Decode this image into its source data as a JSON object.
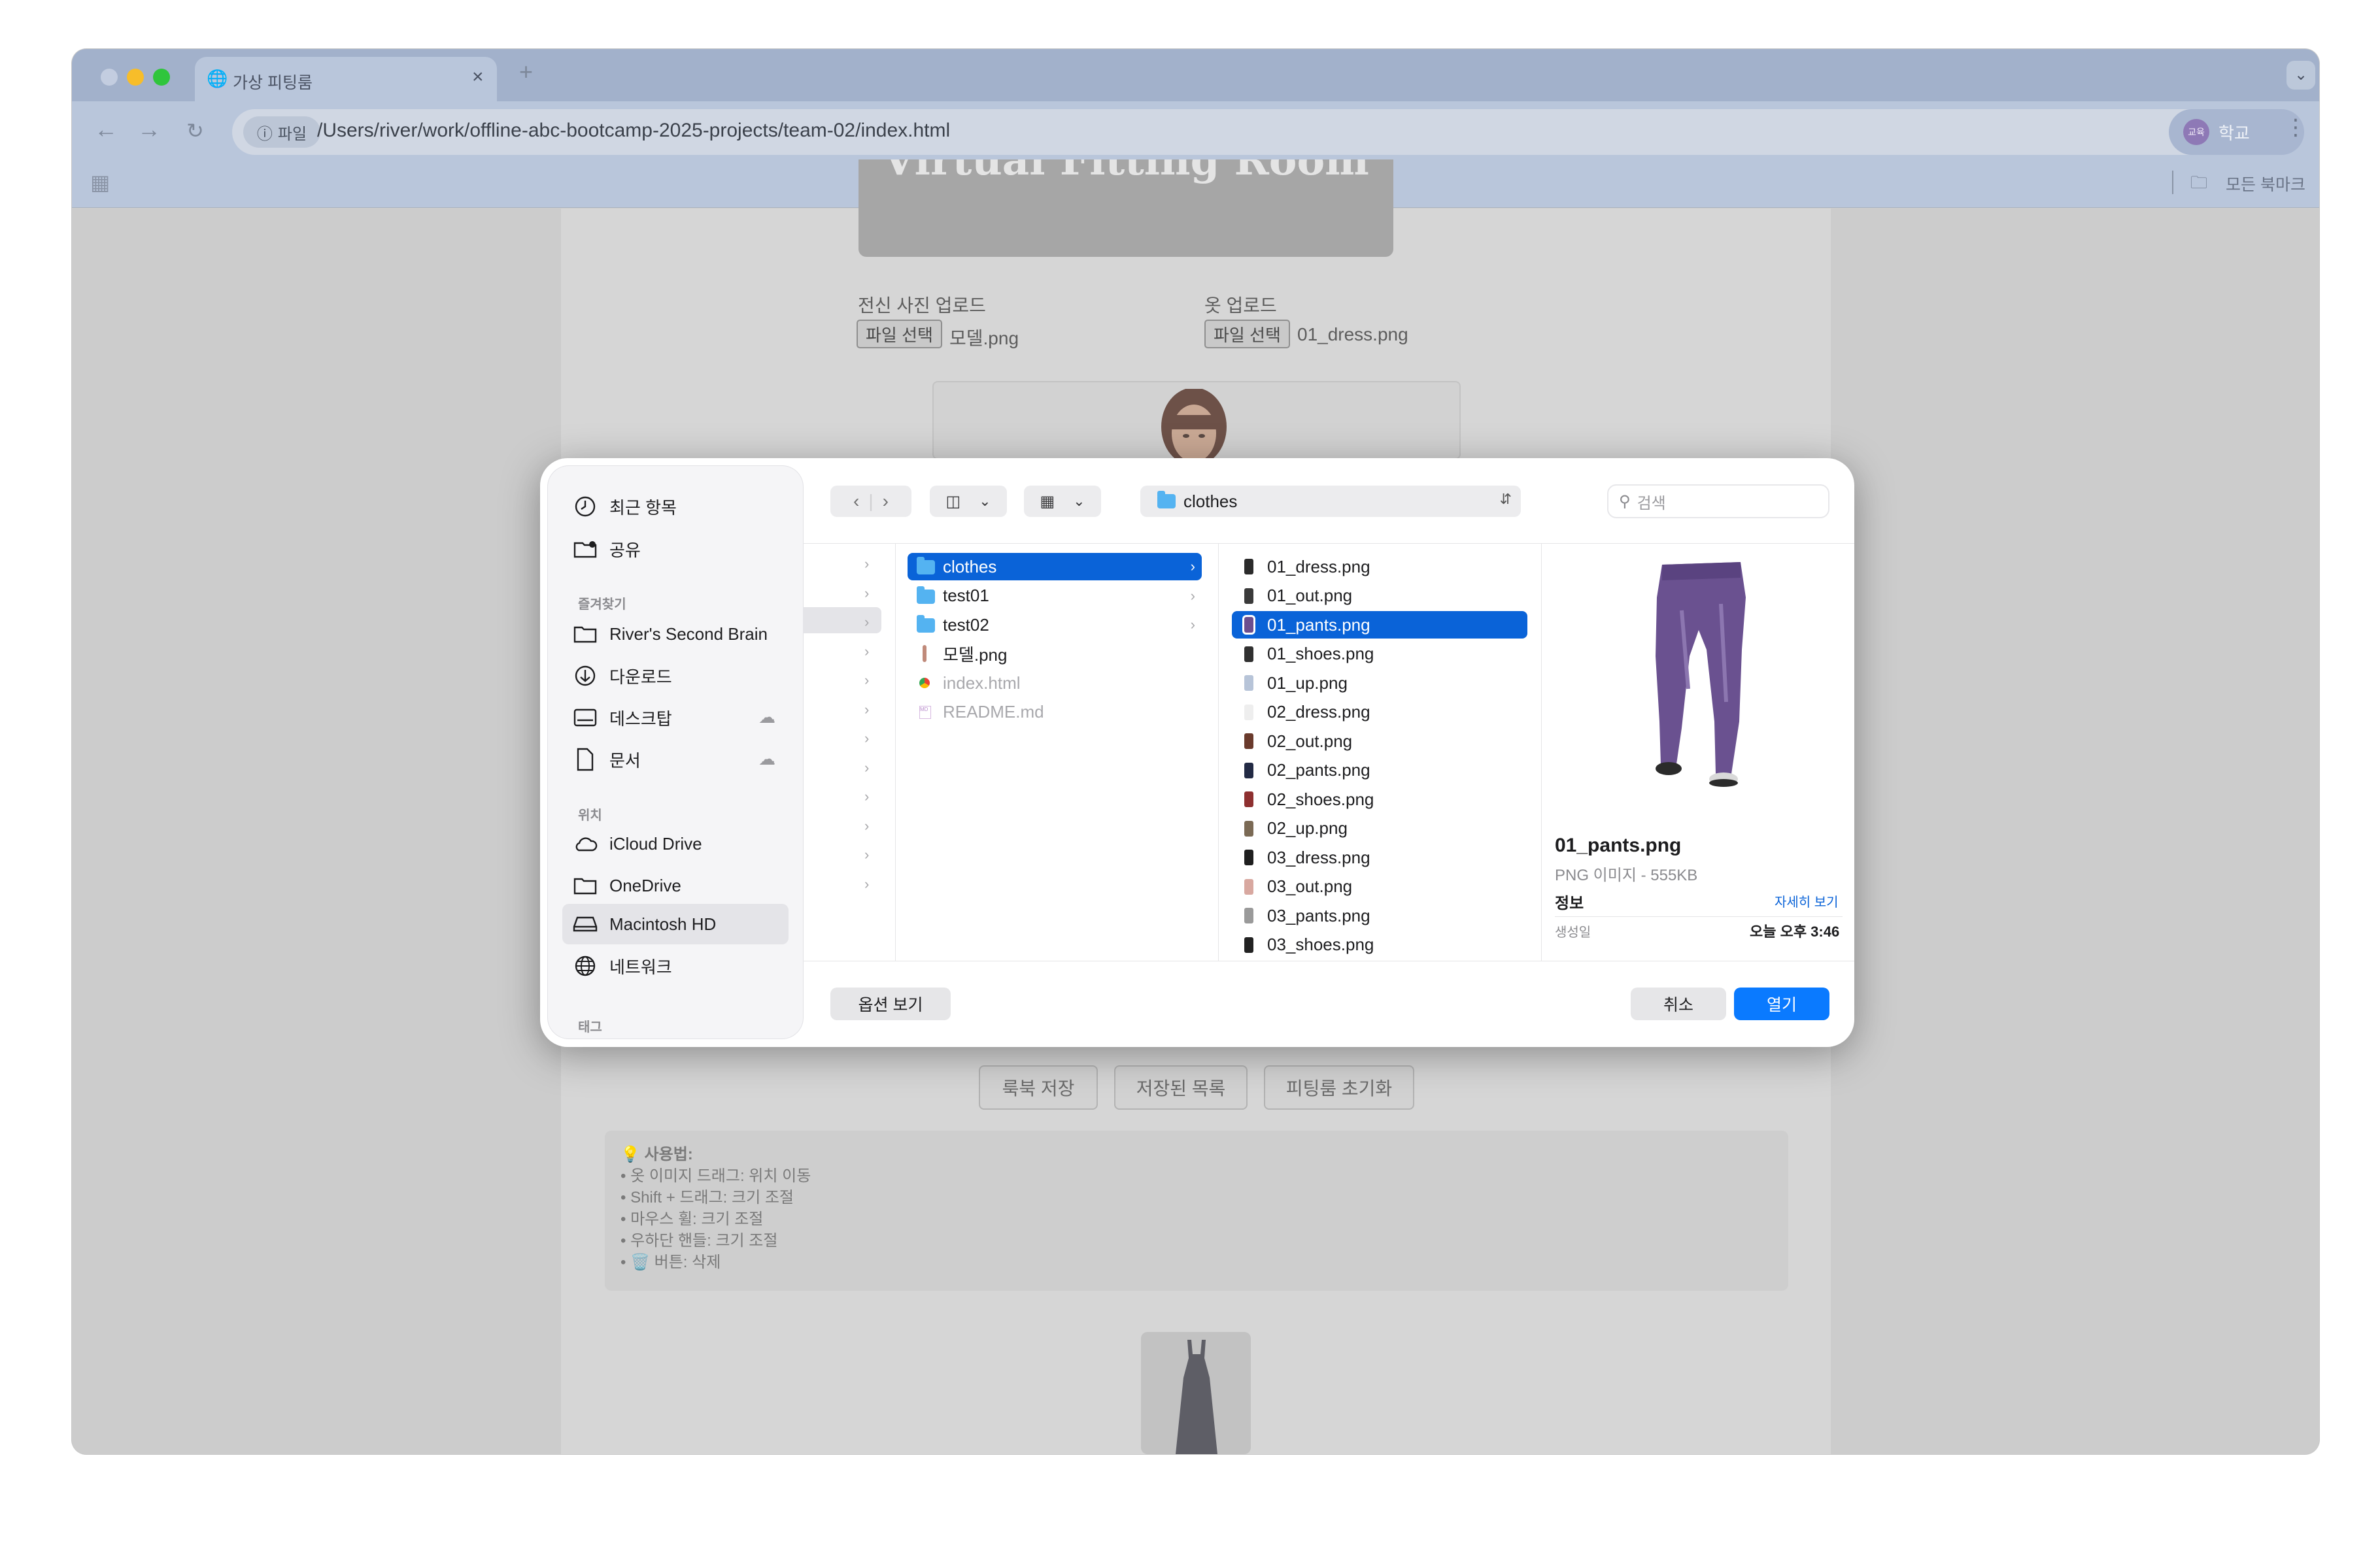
{
  "browser": {
    "tab_title": "가상 피팅룸",
    "url_chip": "파일",
    "url": "/Users/river/work/offline-abc-bootcamp-2025-projects/team-02/index.html",
    "profile_label": "학교",
    "profile_avatar": "교육",
    "bookmarks_label": "모든 북마크",
    "new_tab": "+"
  },
  "page": {
    "title": "Virtual Fitting Room",
    "body_upload_label": "전신 사진 업로드",
    "clothes_upload_label": "옷 업로드",
    "file_button": "파일 선택",
    "body_file": "모델.png",
    "clothes_file": "01_dress.png",
    "buttons": [
      "룩북 저장",
      "저장된 목록",
      "피팅룸 초기화"
    ],
    "help_title": "💡 사용법:",
    "help_lines": [
      "• 옷 이미지 드래그: 위치 이동",
      "• Shift + 드래그: 크기 조절",
      "• 마우스 휠: 크기 조절",
      "• 우하단 핸들: 크기 조절",
      "• 🗑️ 버튼: 삭제"
    ]
  },
  "dialog": {
    "sidebar": {
      "recent": "최근 항목",
      "shared": "공유",
      "favorites_header": "즐겨찾기",
      "favorites": [
        "River's Second Brain",
        "다운로드",
        "데스크탑",
        "문서"
      ],
      "locations_header": "위치",
      "locations": [
        "iCloud Drive",
        "OneDrive",
        "Macintosh HD",
        "네트워크"
      ],
      "tags_header": "태그"
    },
    "path_label": "clothes",
    "search_placeholder": "검색",
    "column2": [
      {
        "name": "clothes",
        "type": "folder",
        "selected": true
      },
      {
        "name": "test01",
        "type": "folder"
      },
      {
        "name": "test02",
        "type": "folder"
      },
      {
        "name": "모델.png",
        "type": "image"
      },
      {
        "name": "index.html",
        "type": "html",
        "dim": true
      },
      {
        "name": "README.md",
        "type": "md",
        "dim": true
      }
    ],
    "column3": [
      {
        "name": "01_dress.png",
        "color": "#2b2b2b"
      },
      {
        "name": "01_out.png",
        "color": "#3a3a3a"
      },
      {
        "name": "01_pants.png",
        "color": "#6b4e8f",
        "selected": true
      },
      {
        "name": "01_shoes.png",
        "color": "#303030"
      },
      {
        "name": "01_up.png",
        "color": "#b7c4d8"
      },
      {
        "name": "02_dress.png",
        "color": "#eeeeee"
      },
      {
        "name": "02_out.png",
        "color": "#6a3a2c"
      },
      {
        "name": "02_pants.png",
        "color": "#222a44"
      },
      {
        "name": "02_shoes.png",
        "color": "#8e3030"
      },
      {
        "name": "02_up.png",
        "color": "#7b6a55"
      },
      {
        "name": "03_dress.png",
        "color": "#1f1f1f"
      },
      {
        "name": "03_out.png",
        "color": "#d8a8a0"
      },
      {
        "name": "03_pants.png",
        "color": "#9a9a9a"
      },
      {
        "name": "03_shoes.png",
        "color": "#222222"
      }
    ],
    "preview": {
      "filename": "01_pants.png",
      "kind": "PNG 이미지 - 555KB",
      "info_label": "정보",
      "more_label": "자세히 보기",
      "created_label": "생성일",
      "created_value": "오늘 오후 3:46"
    },
    "options_button": "옵션 보기",
    "cancel_button": "취소",
    "open_button": "열기"
  },
  "colors": {
    "accent": "#0a63d8",
    "open_button": "#0a7aff"
  }
}
